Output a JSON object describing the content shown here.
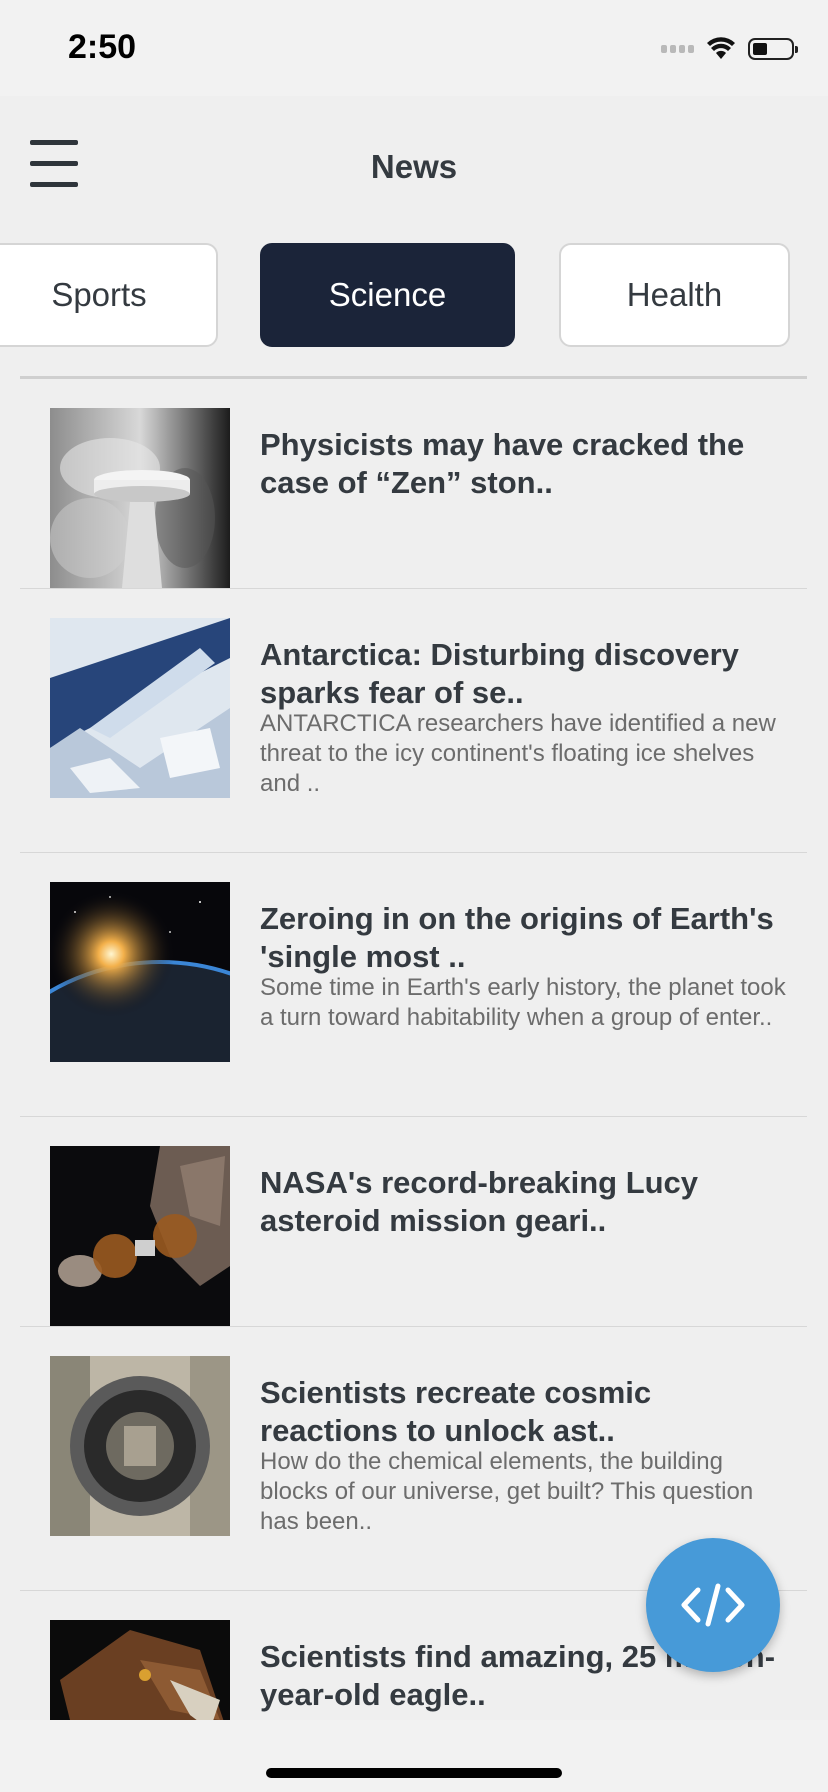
{
  "status": {
    "time": "2:50"
  },
  "header": {
    "title": "News"
  },
  "tabs": [
    {
      "label": "Sports",
      "active": false
    },
    {
      "label": "Science",
      "active": true
    },
    {
      "label": "Health",
      "active": false
    }
  ],
  "articles": [
    {
      "title": "Physicists may have cracked the case of “Zen” ston..",
      "description": ""
    },
    {
      "title": "Antarctica: Disturbing discovery sparks fear of se..",
      "description": "ANTARCTICA researchers have identified a new threat to the icy continent's floating ice shelves and .."
    },
    {
      "title": "Zeroing in on the origins of Earth's 'single most ..",
      "description": "Some time in Earth's early history, the planet took a turn toward habitability when a group of enter.."
    },
    {
      "title": "NASA's record-breaking Lucy asteroid mission geari..",
      "description": ""
    },
    {
      "title": "Scientists recreate cosmic reactions to unlock ast..",
      "description": "How do the chemical elements, the building blocks of our universe, get built? This question has been.."
    },
    {
      "title": "Scientists find amazing, 25 million-year-old eagle..",
      "description": ""
    }
  ],
  "fab": {
    "icon": "code-icon"
  },
  "colors": {
    "active_tab": "#1b2439",
    "fab": "#479ad8",
    "background": "#efefef"
  }
}
